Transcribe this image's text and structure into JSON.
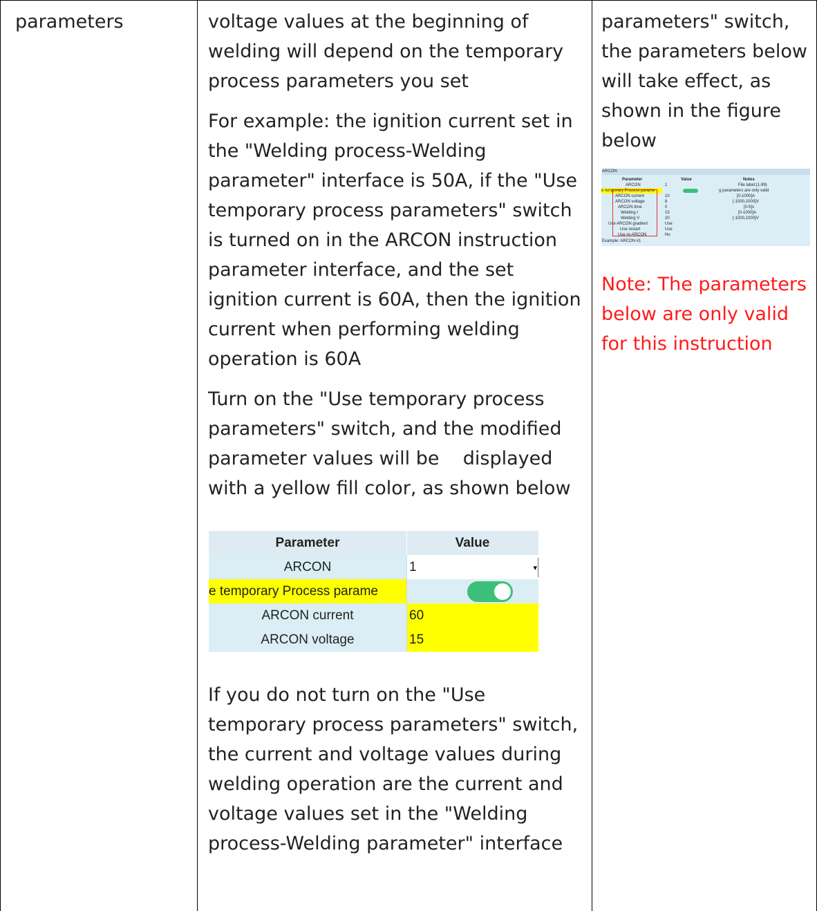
{
  "col1": {
    "text": "parameters"
  },
  "col2": {
    "p1": "voltage values at the beginning of welding will depend on the temporary process parameters you set",
    "p2": "For example: the ignition current set in the \"Welding process-Welding parameter\" interface is 50A, if the \"Use temporary process parameters\" switch is turned on in the ARCON instruction parameter interface, and the set ignition current is 60A, then the ignition current when performing welding operation is 60A",
    "p3": "Turn on the \"Use temporary process parameters\" switch, and the modified parameter values will be    displayed with a yellow fill color, as shown below",
    "p4": "If you do not turn on the \"Use temporary process parameters\" switch, the current and voltage values during welding operation are the current and voltage values set in the \"Welding process-Welding parameter\" interface"
  },
  "screenshot_table": {
    "header_param": "Parameter",
    "header_value": "Value",
    "rows": [
      {
        "param": "ARCON",
        "value": "1"
      },
      {
        "param": "e temporary Process parame",
        "value": ""
      },
      {
        "param": "ARCON current",
        "value": "60"
      },
      {
        "param": "ARCON voltage",
        "value": "15"
      }
    ],
    "colors": {
      "header": "#deebf3",
      "row": "#dbeef5",
      "highlight": "#ffff00",
      "toggle": "#3dbf7c"
    }
  },
  "col3": {
    "text": "parameters\" switch, the parameters below will take effect, as shown in the figure below",
    "note": "Note: The parameters below are only valid for this instruction",
    "note_color": "#ff1a1a"
  },
  "thumbnail": {
    "title": "ARCON",
    "headers": [
      "Parameter",
      "Value",
      "Notes"
    ],
    "rows": [
      [
        "ARCON",
        "1",
        "File label:(1-99)"
      ],
      [
        "e temporary Process parame",
        "",
        "g parameters are only valid"
      ],
      [
        "ARCON current",
        "10",
        "[0-1000]A"
      ],
      [
        "ARCON voltage",
        "8",
        "[-1000,1000]V"
      ],
      [
        "ARCON time",
        "0",
        "[0-5]s"
      ],
      [
        "Welding I",
        "15",
        "[0-1000]A"
      ],
      [
        "Welding V",
        "20",
        "[-1000,1000]V"
      ],
      [
        "Use ARCON gradient",
        "Use",
        ""
      ],
      [
        "Use restart",
        "Use",
        ""
      ],
      [
        "Use re-ARCON",
        "No",
        ""
      ]
    ],
    "footer": "Example: ARCON #1"
  }
}
